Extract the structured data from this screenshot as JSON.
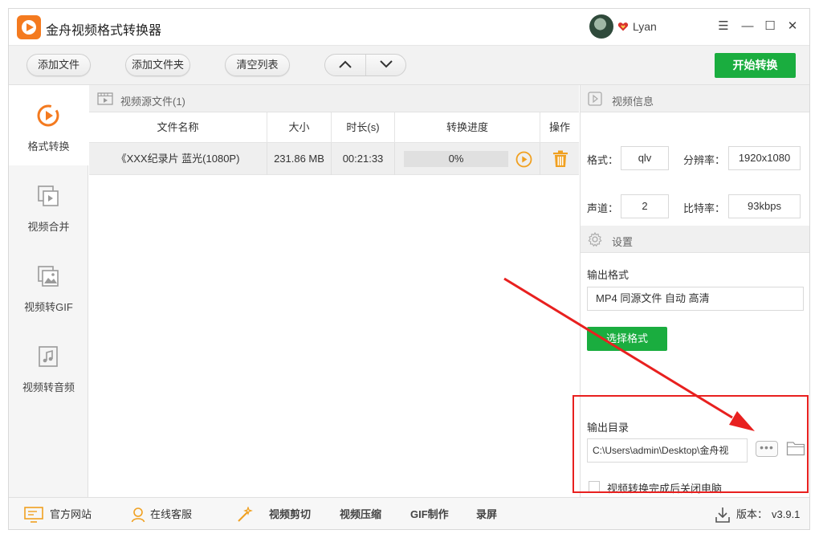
{
  "app": {
    "title": "金舟视频格式转换器",
    "user": "Lyan"
  },
  "window_controls": {
    "menu": "☰",
    "minimize": "—",
    "maximize": "☐",
    "close": "✕"
  },
  "toolbar": {
    "add_file": "添加文件",
    "add_folder": "添加文件夹",
    "clear_list": "清空列表",
    "start": "开始转换"
  },
  "sidebar": {
    "items": [
      {
        "label": "格式转换",
        "icon": "convert-icon",
        "active": true
      },
      {
        "label": "视频合并",
        "icon": "merge-icon",
        "active": false
      },
      {
        "label": "视频转GIF",
        "icon": "gif-icon",
        "active": false
      },
      {
        "label": "视频转音频",
        "icon": "audio-icon",
        "active": false
      }
    ]
  },
  "file_list": {
    "header": "视频源文件(1)",
    "columns": [
      "文件名称",
      "大小",
      "时长(s)",
      "转换进度",
      "操作"
    ],
    "rows": [
      {
        "name": "《XXX纪录片 蓝光(1080P)",
        "size": "231.86 MB",
        "duration": "00:21:33",
        "progress": "0%",
        "progress_value": 0
      }
    ]
  },
  "video_info": {
    "header": "视频信息",
    "format_label": "格式：",
    "format": "qlv",
    "resolution_label": "分辨率：",
    "resolution": "1920x1080",
    "channels_label": "声道：",
    "channels": "2",
    "bitrate_label": "比特率：",
    "bitrate": "93kbps"
  },
  "settings": {
    "header": "设置",
    "output_format_label": "输出格式",
    "output_format": "MP4 同源文件 自动 高清",
    "select_format": "选择格式",
    "output_dir_label": "输出目录",
    "output_dir": "C:\\Users\\admin\\Desktop\\金舟视",
    "more": "•••",
    "shutdown_label": "视频转换完成后关闭电脑",
    "shutdown_checked": false
  },
  "bottom": {
    "website": "官方网站",
    "service": "在线客服",
    "video_cut": "视频剪切",
    "video_compress": "视频压缩",
    "gif_make": "GIF制作",
    "record": "录屏",
    "version_label": "版本：",
    "version": "v3.9.1"
  },
  "colors": {
    "accent_green": "#1aad3f",
    "accent_orange": "#f47a1f",
    "annotation_red": "#e8201f"
  }
}
